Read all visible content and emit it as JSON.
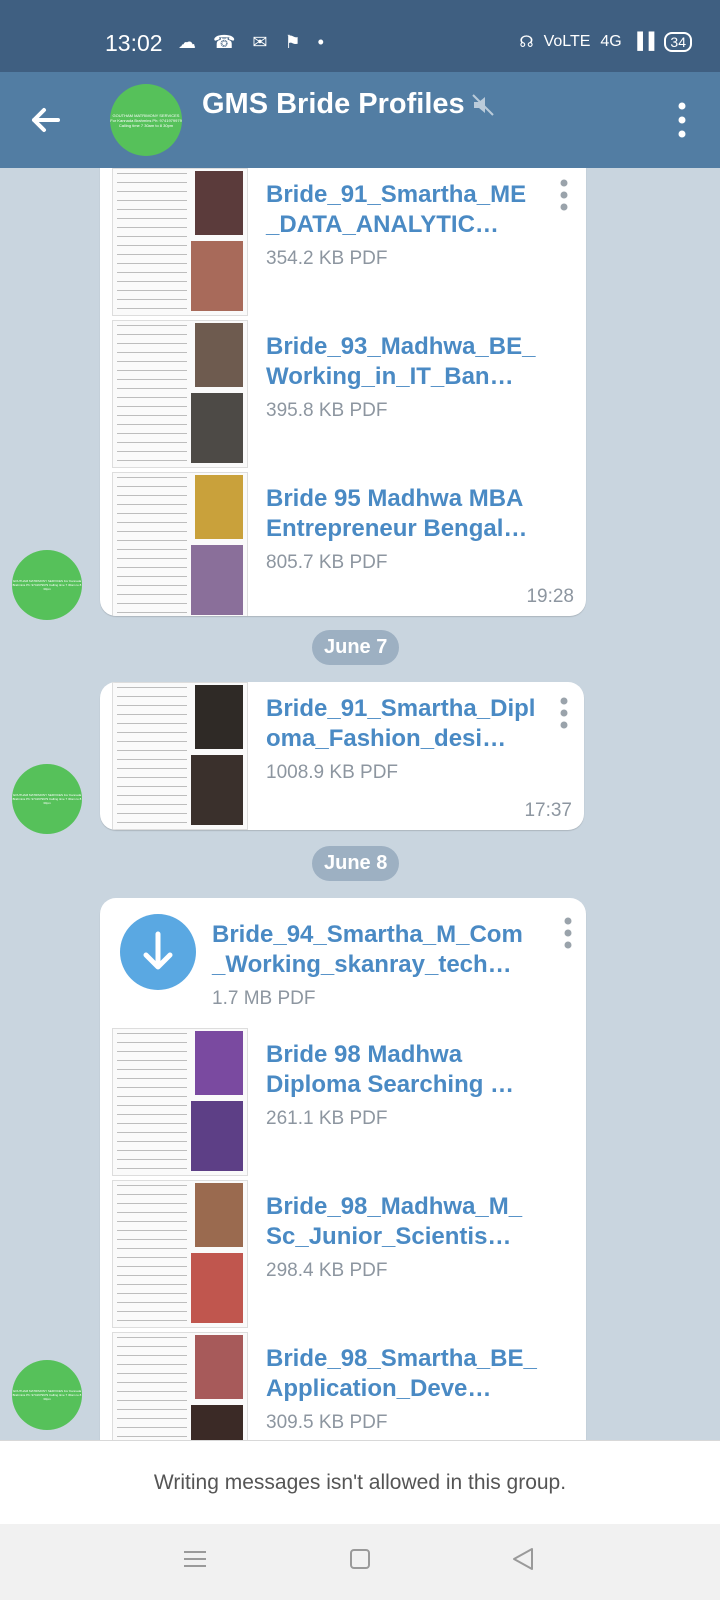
{
  "status": {
    "time": "13:02",
    "left_icons": "☁ ☎ ✉ ⚑ •",
    "right_icons": [
      "☊",
      "VoLTE",
      "4G",
      "▐▐"
    ],
    "battery": "34"
  },
  "header": {
    "title": "GMS Bride Profiles",
    "avatar_text": "GOUTHAM MATRIMONY SERVICES For Kannada Brahmins Ph: 9741979979 Calling time 7 30am to 8 30pm",
    "muted_icon": "muted-icon"
  },
  "messages": [
    {
      "docs": [
        {
          "name": "Bride_91_Smartha_ME\n_DATA_ANALYTIC…",
          "size": "354.2 KB PDF"
        },
        {
          "name": "Bride_93_Madhwa_BE_\nWorking_in_IT_Ban…",
          "size": "395.8 KB PDF"
        },
        {
          "name": "Bride 95 Madhwa MBA\nEntrepreneur Bengal…",
          "size": "805.7 KB PDF"
        }
      ],
      "time": "19:28"
    },
    {
      "date": "June 7",
      "docs": [
        {
          "name": "Bride_91_Smartha_Dipl\noma_Fashion_desi…",
          "size": "1008.9 KB PDF"
        }
      ],
      "time": "17:37"
    },
    {
      "date": "June 8",
      "download_doc": {
        "name": "Bride_94_Smartha_M_Com\n_Working_skanray_tech…",
        "size": "1.7 MB PDF"
      },
      "docs": [
        {
          "name": "Bride 98 Madhwa\nDiploma Searching …",
          "size": "261.1 KB PDF"
        },
        {
          "name": "Bride_98_Madhwa_M_\nSc_Junior_Scientis…",
          "size": "298.4 KB PDF"
        },
        {
          "name": "Bride_98_Smartha_BE_\nApplication_Deve…",
          "size": "309.5 KB PDF"
        }
      ]
    }
  ],
  "footer": {
    "restricted_text": "Writing messages isn't allowed in this group."
  },
  "colors": {
    "header": "#527da3",
    "status": "#3f5f81",
    "link": "#4a8ac4",
    "avatar": "#56c15a",
    "background": "#c9d5df"
  }
}
